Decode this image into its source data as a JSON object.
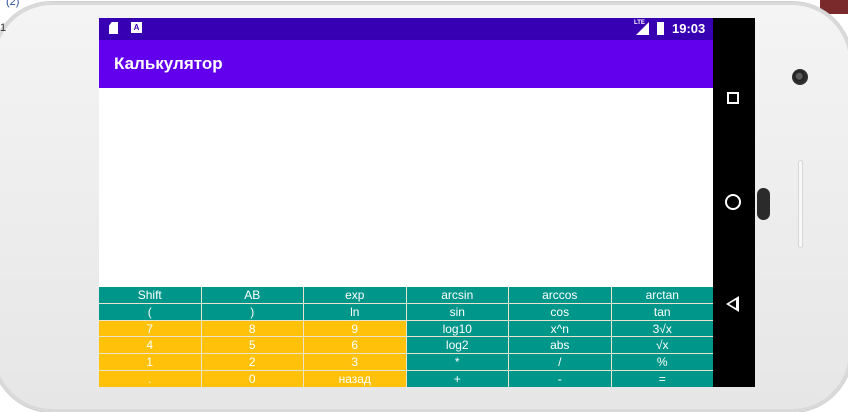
{
  "page": {
    "label": "(2)",
    "number": "1"
  },
  "statusbar": {
    "time": "19:03",
    "network": "LTE",
    "icons": [
      "sd-card-icon",
      "a-notification-icon",
      "lte-signal-icon",
      "battery-icon"
    ]
  },
  "app": {
    "title": "Калькулятор",
    "display_value": ""
  },
  "colors": {
    "statusbar": "#3700b3",
    "appbar": "#6200ee",
    "key_teal": "#00968a",
    "key_amber": "#ffc10a",
    "navbar": "#000000"
  },
  "keypad": {
    "rows": [
      [
        "Shift",
        "AB",
        "exp",
        "arcsin",
        "arccos",
        "arctan"
      ],
      [
        "(",
        ")",
        "ln",
        "sin",
        "cos",
        "tan"
      ],
      [
        "7",
        "8",
        "9",
        "log10",
        "x^n",
        "3√x"
      ],
      [
        "4",
        "5",
        "6",
        "log2",
        "abs",
        "√x"
      ],
      [
        "1",
        "2",
        "3",
        "*",
        "/",
        "%"
      ],
      [
        ".",
        "0",
        "назад",
        "+",
        "-",
        "="
      ]
    ]
  },
  "navbar": {
    "buttons": [
      "recents-icon",
      "home-icon",
      "back-icon"
    ]
  }
}
